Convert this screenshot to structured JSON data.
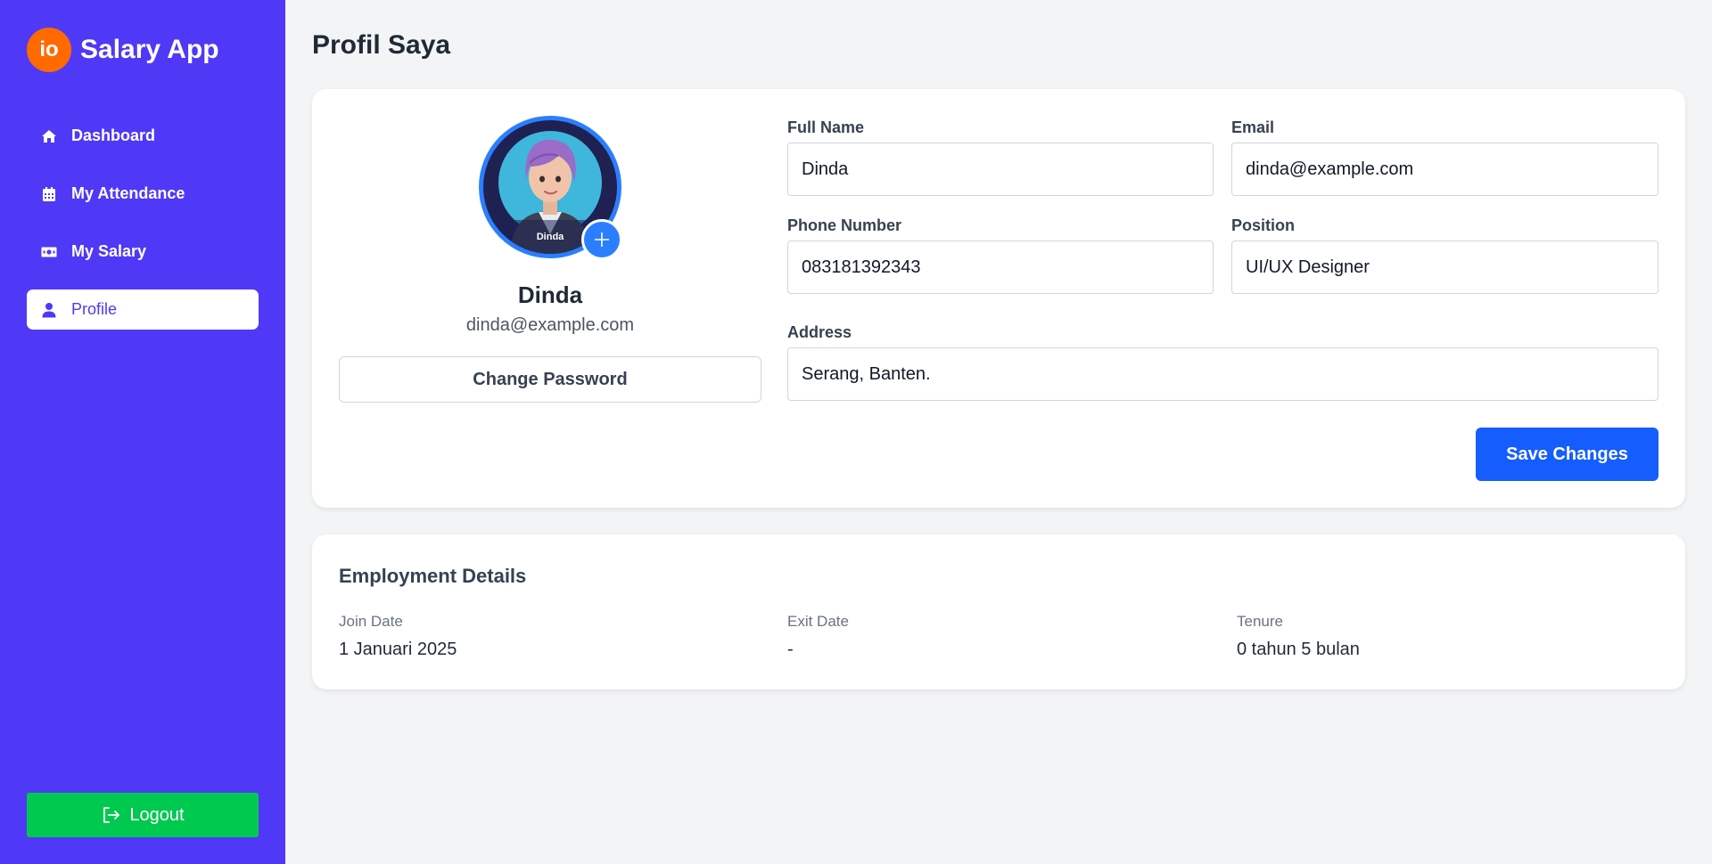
{
  "brand": {
    "logo_text": "io",
    "name": "Salary App"
  },
  "nav": {
    "items": [
      {
        "label": "Dashboard",
        "icon": "home-icon"
      },
      {
        "label": "My Attendance",
        "icon": "calendar-icon"
      },
      {
        "label": "My Salary",
        "icon": "money-bill-icon"
      },
      {
        "label": "Profile",
        "icon": "user-icon",
        "active": true
      }
    ],
    "logout_label": "Logout"
  },
  "page": {
    "title": "Profil Saya"
  },
  "profile": {
    "avatar_caption": "Dinda",
    "name": "Dinda",
    "email": "dinda@example.com",
    "change_password_label": "Change Password"
  },
  "form": {
    "full_name": {
      "label": "Full Name",
      "value": "Dinda"
    },
    "email": {
      "label": "Email",
      "value": "dinda@example.com"
    },
    "phone": {
      "label": "Phone Number",
      "value": "083181392343"
    },
    "position": {
      "label": "Position",
      "value": "UI/UX Designer"
    },
    "address": {
      "label": "Address",
      "value": "Serang, Banten."
    },
    "save_label": "Save Changes"
  },
  "employment": {
    "title": "Employment Details",
    "join_date": {
      "label": "Join Date",
      "value": "1 Januari 2025"
    },
    "exit_date": {
      "label": "Exit Date",
      "value": "-"
    },
    "tenure": {
      "label": "Tenure",
      "value": "0 tahun 5 bulan"
    }
  },
  "colors": {
    "sidebar": "#4f39f6",
    "primary": "#155dfc",
    "logout": "#00c950",
    "brand_logo": "#ff6a00"
  }
}
